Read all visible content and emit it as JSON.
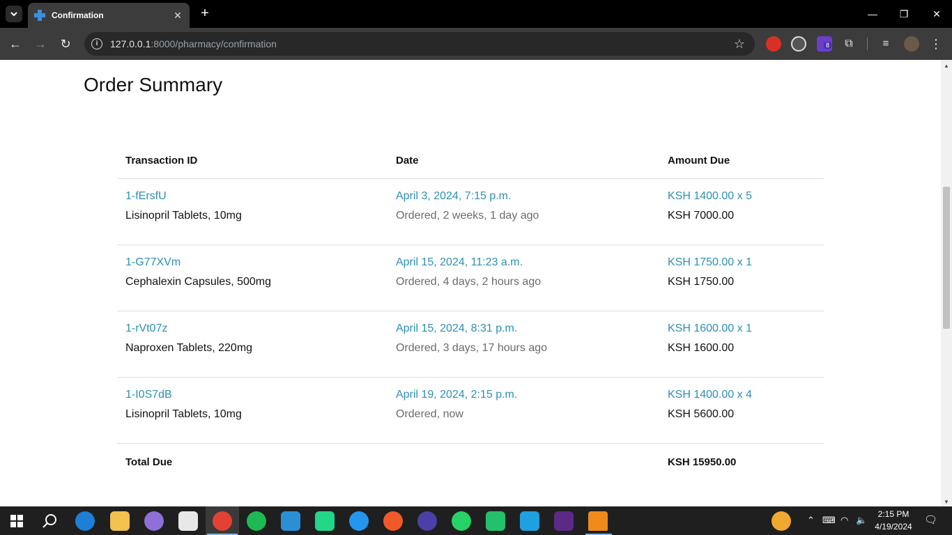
{
  "browser": {
    "tab_title": "Confirmation",
    "url_host": "127.0.0.1",
    "url_path": ":8000/pharmacy/confirmation",
    "extension_badge": "8"
  },
  "page": {
    "title": "Order Summary",
    "columns": [
      "Transaction ID",
      "Date",
      "Amount Due"
    ],
    "orders": [
      {
        "id": "1-fErsfU",
        "product": "Lisinopril Tablets, 10mg",
        "date": "April 3, 2024, 7:15 p.m.",
        "ordered": "Ordered, 2 weeks, 1 day ago",
        "unit": "KSH 1400.00 x 5",
        "amount": "KSH 7000.00"
      },
      {
        "id": "1-G77XVm",
        "product": "Cephalexin Capsules, 500mg",
        "date": "April 15, 2024, 11:23 a.m.",
        "ordered": "Ordered, 4 days, 2 hours ago",
        "unit": "KSH 1750.00 x 1",
        "amount": "KSH 1750.00"
      },
      {
        "id": "1-rVt07z",
        "product": "Naproxen Tablets, 220mg",
        "date": "April 15, 2024, 8:31 p.m.",
        "ordered": "Ordered, 3 days, 17 hours ago",
        "unit": "KSH 1600.00 x 1",
        "amount": "KSH 1600.00"
      },
      {
        "id": "1-I0S7dB",
        "product": "Lisinopril Tablets, 10mg",
        "date": "April 19, 2024, 2:15 p.m.",
        "ordered": "Ordered, now",
        "unit": "KSH 1400.00 x 4",
        "amount": "KSH 5600.00"
      }
    ],
    "total_label": "Total Due",
    "total_value": "KSH 15950.00"
  },
  "taskbar": {
    "time": "2:15 PM",
    "date": "4/19/2024"
  },
  "colors": {
    "link": "#2e8fb5",
    "muted": "#6b6b6b",
    "chrome_bg": "#3c3c3c"
  }
}
